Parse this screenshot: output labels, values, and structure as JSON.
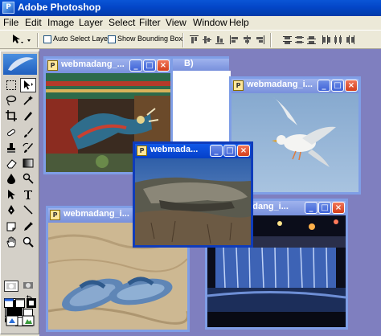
{
  "app": {
    "title": "Adobe Photoshop",
    "icon_letter": "P"
  },
  "menu": [
    "File",
    "Edit",
    "Image",
    "Layer",
    "Select",
    "Filter",
    "View",
    "Window",
    "Help"
  ],
  "options": {
    "auto_select_label": "Auto Select Layer",
    "bounding_box_label": "Show Bounding Box",
    "auto_select_checked": false,
    "bounding_box_checked": false
  },
  "documents": [
    {
      "id": "dragon",
      "title": "webmadang_...",
      "behind_title": "B)",
      "active": false
    },
    {
      "id": "seagull",
      "title": "webmadang_i...",
      "active": false
    },
    {
      "id": "rock",
      "title": "webmada...",
      "active": true
    },
    {
      "id": "sandals",
      "title": "webmadang_i...",
      "active": false
    },
    {
      "id": "waterfall",
      "title": "webmadang_i...",
      "active": false
    }
  ],
  "caption_buttons": {
    "minimize": "_",
    "maximize": "□",
    "close": "×"
  },
  "colors": {
    "foreground": "#000000",
    "background": "#ffffff",
    "workspace": "#7f7fbf",
    "active_caption": "#0f3cbb"
  }
}
